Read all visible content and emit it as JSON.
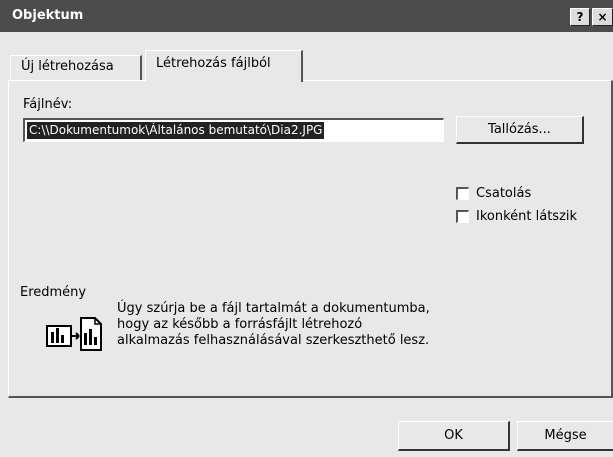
{
  "window": {
    "title": "Objektum",
    "help_label": "?",
    "close_label": "×"
  },
  "tabs": [
    {
      "label": "Új létrehozása"
    },
    {
      "label": "Létrehozás fájlból"
    }
  ],
  "file": {
    "label": "Fájlnév:",
    "value": "C:\\\\Dokumentumok\\Általános bemutató\\Dia2.JPG",
    "browse_label": "Tallózás..."
  },
  "options": [
    {
      "label": "Csatolás",
      "checked": false
    },
    {
      "label": "Ikonként látszik",
      "checked": false
    }
  ],
  "result": {
    "heading": "Eredmény",
    "lines": [
      "Úgy szúrja be a fájl tartalmát a dokumentumba,",
      "hogy az később a forrásfájlt létrehozó",
      "alkalmazás felhasználásával szerkeszthető lesz."
    ],
    "icon": "embed-document-icon"
  },
  "buttons": {
    "ok": "OK",
    "cancel": "Mégse"
  }
}
